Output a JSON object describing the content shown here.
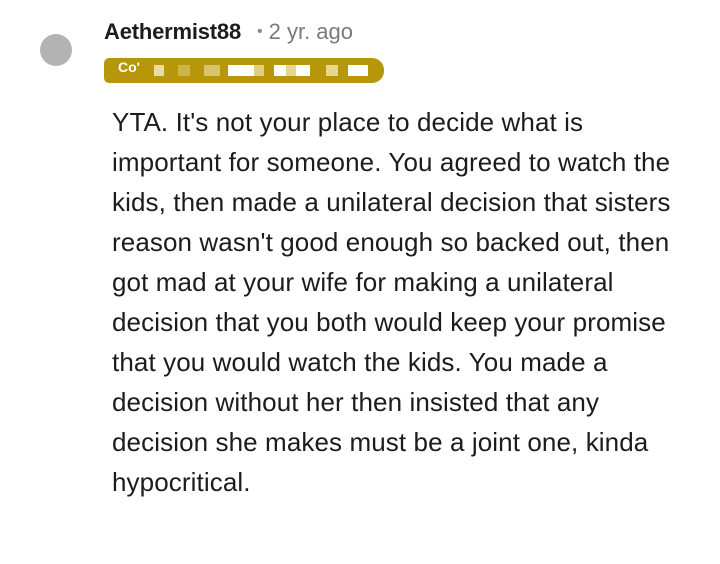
{
  "comment": {
    "username": "Aethermist88",
    "separator": "•",
    "timestamp": "2 yr. ago",
    "flair_text": "Co'",
    "flair_color": "#b8960a",
    "avatar_color": "#b3b3b3",
    "body": "YTA. It's not your place to decide what is important for someone. You agreed to watch the kids, then made a unilateral decision that sisters reason wasn't good enough so backed out, then got mad at your wife for making a unilateral decision that you both would keep your promise that you would watch the kids. You made a decision without her then insisted that any decision she makes must be a joint one, kinda hypocritical."
  }
}
